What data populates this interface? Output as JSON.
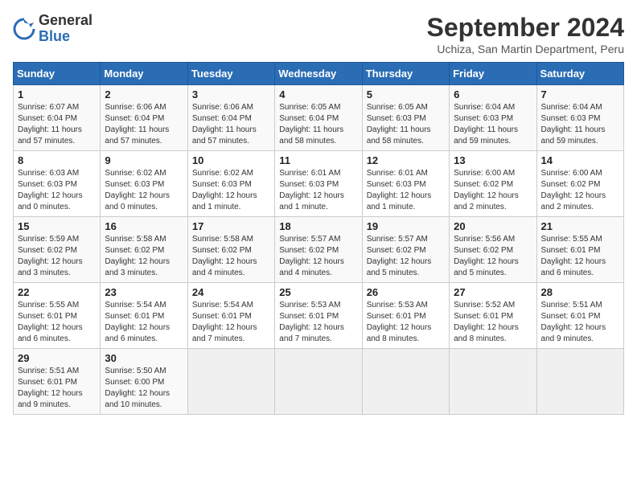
{
  "header": {
    "logo_general": "General",
    "logo_blue": "Blue",
    "month_title": "September 2024",
    "subtitle": "Uchiza, San Martin Department, Peru"
  },
  "weekdays": [
    "Sunday",
    "Monday",
    "Tuesday",
    "Wednesday",
    "Thursday",
    "Friday",
    "Saturday"
  ],
  "weeks": [
    [
      {
        "day": "1",
        "sunrise": "Sunrise: 6:07 AM",
        "sunset": "Sunset: 6:04 PM",
        "daylight": "Daylight: 11 hours and 57 minutes."
      },
      {
        "day": "2",
        "sunrise": "Sunrise: 6:06 AM",
        "sunset": "Sunset: 6:04 PM",
        "daylight": "Daylight: 11 hours and 57 minutes."
      },
      {
        "day": "3",
        "sunrise": "Sunrise: 6:06 AM",
        "sunset": "Sunset: 6:04 PM",
        "daylight": "Daylight: 11 hours and 57 minutes."
      },
      {
        "day": "4",
        "sunrise": "Sunrise: 6:05 AM",
        "sunset": "Sunset: 6:04 PM",
        "daylight": "Daylight: 11 hours and 58 minutes."
      },
      {
        "day": "5",
        "sunrise": "Sunrise: 6:05 AM",
        "sunset": "Sunset: 6:03 PM",
        "daylight": "Daylight: 11 hours and 58 minutes."
      },
      {
        "day": "6",
        "sunrise": "Sunrise: 6:04 AM",
        "sunset": "Sunset: 6:03 PM",
        "daylight": "Daylight: 11 hours and 59 minutes."
      },
      {
        "day": "7",
        "sunrise": "Sunrise: 6:04 AM",
        "sunset": "Sunset: 6:03 PM",
        "daylight": "Daylight: 11 hours and 59 minutes."
      }
    ],
    [
      {
        "day": "8",
        "sunrise": "Sunrise: 6:03 AM",
        "sunset": "Sunset: 6:03 PM",
        "daylight": "Daylight: 12 hours and 0 minutes."
      },
      {
        "day": "9",
        "sunrise": "Sunrise: 6:02 AM",
        "sunset": "Sunset: 6:03 PM",
        "daylight": "Daylight: 12 hours and 0 minutes."
      },
      {
        "day": "10",
        "sunrise": "Sunrise: 6:02 AM",
        "sunset": "Sunset: 6:03 PM",
        "daylight": "Daylight: 12 hours and 1 minute."
      },
      {
        "day": "11",
        "sunrise": "Sunrise: 6:01 AM",
        "sunset": "Sunset: 6:03 PM",
        "daylight": "Daylight: 12 hours and 1 minute."
      },
      {
        "day": "12",
        "sunrise": "Sunrise: 6:01 AM",
        "sunset": "Sunset: 6:03 PM",
        "daylight": "Daylight: 12 hours and 1 minute."
      },
      {
        "day": "13",
        "sunrise": "Sunrise: 6:00 AM",
        "sunset": "Sunset: 6:02 PM",
        "daylight": "Daylight: 12 hours and 2 minutes."
      },
      {
        "day": "14",
        "sunrise": "Sunrise: 6:00 AM",
        "sunset": "Sunset: 6:02 PM",
        "daylight": "Daylight: 12 hours and 2 minutes."
      }
    ],
    [
      {
        "day": "15",
        "sunrise": "Sunrise: 5:59 AM",
        "sunset": "Sunset: 6:02 PM",
        "daylight": "Daylight: 12 hours and 3 minutes."
      },
      {
        "day": "16",
        "sunrise": "Sunrise: 5:58 AM",
        "sunset": "Sunset: 6:02 PM",
        "daylight": "Daylight: 12 hours and 3 minutes."
      },
      {
        "day": "17",
        "sunrise": "Sunrise: 5:58 AM",
        "sunset": "Sunset: 6:02 PM",
        "daylight": "Daylight: 12 hours and 4 minutes."
      },
      {
        "day": "18",
        "sunrise": "Sunrise: 5:57 AM",
        "sunset": "Sunset: 6:02 PM",
        "daylight": "Daylight: 12 hours and 4 minutes."
      },
      {
        "day": "19",
        "sunrise": "Sunrise: 5:57 AM",
        "sunset": "Sunset: 6:02 PM",
        "daylight": "Daylight: 12 hours and 5 minutes."
      },
      {
        "day": "20",
        "sunrise": "Sunrise: 5:56 AM",
        "sunset": "Sunset: 6:02 PM",
        "daylight": "Daylight: 12 hours and 5 minutes."
      },
      {
        "day": "21",
        "sunrise": "Sunrise: 5:55 AM",
        "sunset": "Sunset: 6:01 PM",
        "daylight": "Daylight: 12 hours and 6 minutes."
      }
    ],
    [
      {
        "day": "22",
        "sunrise": "Sunrise: 5:55 AM",
        "sunset": "Sunset: 6:01 PM",
        "daylight": "Daylight: 12 hours and 6 minutes."
      },
      {
        "day": "23",
        "sunrise": "Sunrise: 5:54 AM",
        "sunset": "Sunset: 6:01 PM",
        "daylight": "Daylight: 12 hours and 6 minutes."
      },
      {
        "day": "24",
        "sunrise": "Sunrise: 5:54 AM",
        "sunset": "Sunset: 6:01 PM",
        "daylight": "Daylight: 12 hours and 7 minutes."
      },
      {
        "day": "25",
        "sunrise": "Sunrise: 5:53 AM",
        "sunset": "Sunset: 6:01 PM",
        "daylight": "Daylight: 12 hours and 7 minutes."
      },
      {
        "day": "26",
        "sunrise": "Sunrise: 5:53 AM",
        "sunset": "Sunset: 6:01 PM",
        "daylight": "Daylight: 12 hours and 8 minutes."
      },
      {
        "day": "27",
        "sunrise": "Sunrise: 5:52 AM",
        "sunset": "Sunset: 6:01 PM",
        "daylight": "Daylight: 12 hours and 8 minutes."
      },
      {
        "day": "28",
        "sunrise": "Sunrise: 5:51 AM",
        "sunset": "Sunset: 6:01 PM",
        "daylight": "Daylight: 12 hours and 9 minutes."
      }
    ],
    [
      {
        "day": "29",
        "sunrise": "Sunrise: 5:51 AM",
        "sunset": "Sunset: 6:01 PM",
        "daylight": "Daylight: 12 hours and 9 minutes."
      },
      {
        "day": "30",
        "sunrise": "Sunrise: 5:50 AM",
        "sunset": "Sunset: 6:00 PM",
        "daylight": "Daylight: 12 hours and 10 minutes."
      },
      null,
      null,
      null,
      null,
      null
    ]
  ]
}
